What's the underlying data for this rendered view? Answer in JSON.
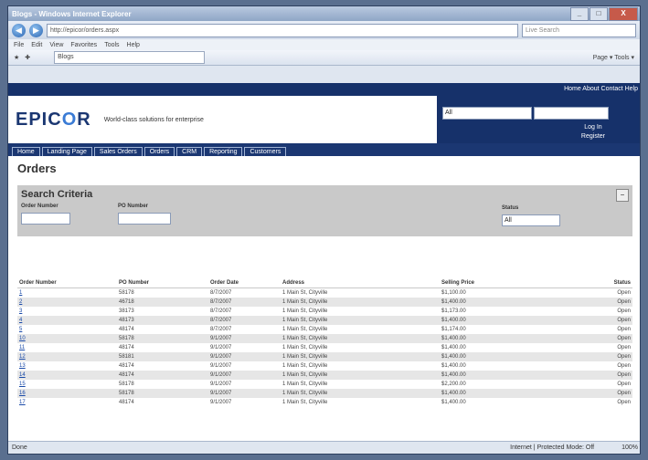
{
  "window": {
    "title": "Blogs - Windows Internet Explorer",
    "buttons": {
      "min": "_",
      "max": "□",
      "close": "X"
    }
  },
  "browser": {
    "back_icon": "back-arrow-icon",
    "forward_icon": "forward-arrow-icon",
    "address": "http://epicor/orders.aspx",
    "search_placeholder": "Live Search",
    "menu": [
      "File",
      "Edit",
      "View",
      "Favorites",
      "Tools",
      "Help"
    ],
    "fav_tab": "Blogs",
    "tools_label": "Page ▾  Tools ▾"
  },
  "site": {
    "topband": "Home  About  Contact  Help",
    "logo_main": "EPIC",
    "logo_accent": "O",
    "logo_tail": "R",
    "tagline": "World-class solutions for enterprise",
    "header_select": "All",
    "header_link_1": "Log In",
    "header_link_2": "Register",
    "nav": [
      "Home",
      "Landing Page",
      "Sales Orders",
      "Orders",
      "CRM",
      "Reporting",
      "Customers"
    ]
  },
  "page": {
    "title": "Orders",
    "criteria": {
      "title": "Search Criteria",
      "label_order": "Order Number",
      "label_po": "PO Number",
      "label_status": "Status",
      "status_value": "All",
      "toggle": "−"
    }
  },
  "table": {
    "headers": [
      "Order Number",
      "PO Number",
      "Order Date",
      "Address",
      "Selling Price",
      "Status"
    ],
    "rows": [
      [
        "1",
        "58178",
        "8/7/2007",
        "1 Main St, Cityville",
        "$1,100.00",
        "Open"
      ],
      [
        "2",
        "46718",
        "8/7/2007",
        "1 Main St, Cityville",
        "$1,400.00",
        "Open"
      ],
      [
        "3",
        "38173",
        "8/7/2007",
        "1 Main St, Cityville",
        "$1,173.00",
        "Open"
      ],
      [
        "4",
        "48173",
        "8/7/2007",
        "1 Main St, Cityville",
        "$1,400.00",
        "Open"
      ],
      [
        "5",
        "48174",
        "8/7/2007",
        "1 Main St, Cityville",
        "$1,174.00",
        "Open"
      ],
      [
        "10",
        "58178",
        "9/1/2007",
        "1 Main St, Cityville",
        "$1,400.00",
        "Open"
      ],
      [
        "11",
        "48174",
        "9/1/2007",
        "1 Main St, Cityville",
        "$1,400.00",
        "Open"
      ],
      [
        "12",
        "58181",
        "9/1/2007",
        "1 Main St, Cityville",
        "$1,400.00",
        "Open"
      ],
      [
        "13",
        "48174",
        "9/1/2007",
        "1 Main St, Cityville",
        "$1,400.00",
        "Open"
      ],
      [
        "14",
        "48174",
        "9/1/2007",
        "1 Main St, Cityville",
        "$1,400.00",
        "Open"
      ],
      [
        "15",
        "58178",
        "9/1/2007",
        "1 Main St, Cityville",
        "$2,200.00",
        "Open"
      ],
      [
        "16",
        "58178",
        "9/1/2007",
        "1 Main St, Cityville",
        "$1,400.00",
        "Open"
      ],
      [
        "17",
        "48174",
        "9/1/2007",
        "1 Main St, Cityville",
        "$1,400.00",
        "Open"
      ]
    ]
  },
  "status": {
    "left": "Done",
    "zone": "Internet | Protected Mode: Off",
    "zoom": "100%"
  }
}
